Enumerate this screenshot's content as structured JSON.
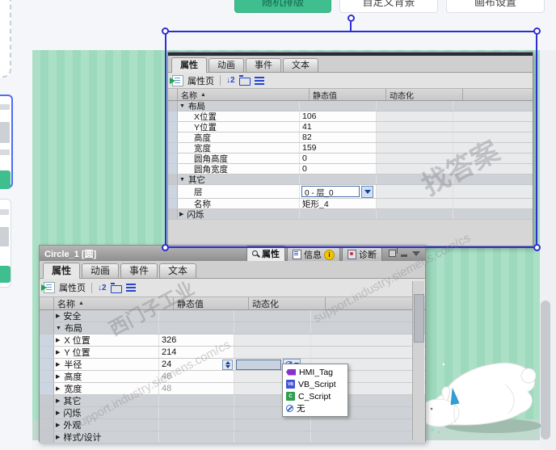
{
  "top_buttons": {
    "randomize": "随机排版",
    "custom_background": "自定义背景",
    "canvas_settings": "画布设置"
  },
  "floating_panel": {
    "tabs": [
      "属性",
      "动画",
      "事件",
      "文本"
    ],
    "active_tab": "属性",
    "toolbar": {
      "property_page_label": "属性页",
      "sort_glyph": "↓2"
    },
    "columns": {
      "name": "名称",
      "static": "静态值",
      "dynamic": "动态化"
    },
    "rows": [
      {
        "id": "layout",
        "type": "group",
        "label": "布局",
        "expanded": true
      },
      {
        "id": "x-position",
        "label": "X位置",
        "value": "106"
      },
      {
        "id": "y-position",
        "label": "Y位置",
        "value": "41"
      },
      {
        "id": "height",
        "label": "高度",
        "value": "82"
      },
      {
        "id": "width",
        "label": "宽度",
        "value": "159"
      },
      {
        "id": "corner-height",
        "label": "圆角高度",
        "value": "0"
      },
      {
        "id": "corner-width",
        "label": "圆角宽度",
        "value": "0"
      },
      {
        "id": "other",
        "type": "group",
        "label": "其它",
        "expanded": true
      },
      {
        "id": "layer",
        "label": "层",
        "value": "0 - 层_0",
        "control": "dropdown"
      },
      {
        "id": "name",
        "label": "名称",
        "value": "矩形_4"
      },
      {
        "id": "blink",
        "type": "group",
        "label": "闪烁",
        "expanded": false
      }
    ]
  },
  "bottom_panel": {
    "title": "Circle_1 [圆]",
    "dock_tabs": [
      {
        "label": "属性",
        "active": true
      },
      {
        "label": "信息",
        "badge": "i"
      },
      {
        "label": "诊断"
      }
    ],
    "tabs": [
      "属性",
      "动画",
      "事件",
      "文本"
    ],
    "active_tab": "属性",
    "toolbar": {
      "property_page_label": "属性页",
      "sort_glyph": "↓2"
    },
    "columns": {
      "name": "名称",
      "static": "静态值",
      "dynamic": "动态化"
    },
    "rows": [
      {
        "id": "security",
        "type": "group",
        "label": "安全",
        "expanded": false
      },
      {
        "id": "layout",
        "type": "group",
        "label": "布局",
        "expanded": true
      },
      {
        "id": "x-position",
        "label": "X 位置",
        "value": "326",
        "arrow": true
      },
      {
        "id": "y-position",
        "label": "Y 位置",
        "value": "214",
        "arrow": true
      },
      {
        "id": "radius",
        "label": "半径",
        "value": "24",
        "arrow": true,
        "control": "dynamic-editor"
      },
      {
        "id": "height",
        "label": "高度",
        "value": "48",
        "arrow": true,
        "muted": true
      },
      {
        "id": "width",
        "label": "宽度",
        "value": "48",
        "arrow": true,
        "muted": true
      },
      {
        "id": "other",
        "type": "group",
        "label": "其它",
        "expanded": false
      },
      {
        "id": "blink",
        "type": "group",
        "label": "闪烁",
        "expanded": false
      },
      {
        "id": "appearance",
        "type": "group",
        "label": "外观",
        "expanded": false
      },
      {
        "id": "style-design",
        "type": "group",
        "label": "样式/设计",
        "expanded": false
      }
    ],
    "dynamization_menu": [
      {
        "label": "HMI_Tag",
        "icon": "hmi-tag-icon",
        "glyph": "VB"
      },
      {
        "label": "VB_Script",
        "icon": "vb-script-icon",
        "glyph": "VB"
      },
      {
        "label": "C_Script",
        "icon": "c-script-icon",
        "glyph": "C"
      },
      {
        "label": "无",
        "icon": "none-icon",
        "glyph": ""
      }
    ]
  },
  "watermarks": {
    "w1": "找答案",
    "w2": "support.industry.siemens.com/cs",
    "w3": "西门子工业",
    "w4": "support.industry.siemens.com/cs"
  },
  "colors": {
    "accent_green": "#3fbf8f",
    "selection_blue": "#2e2ed0",
    "stripe_light": "#abe0c6",
    "stripe_dark": "#9dd9bc"
  }
}
